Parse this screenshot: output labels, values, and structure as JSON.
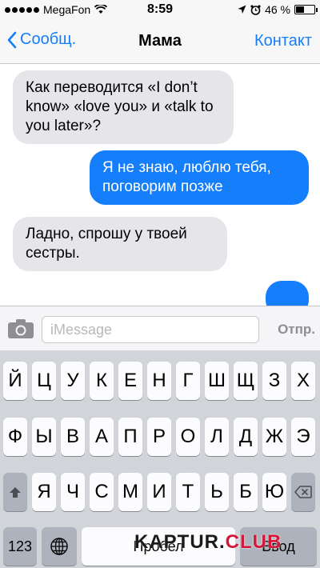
{
  "status_bar": {
    "carrier": "MegaFon",
    "time": "8:59",
    "battery_percent": "46 %",
    "battery_level": 0.46,
    "icons": [
      "signal-dots",
      "wifi-icon",
      "location-arrow-icon",
      "alarm-icon",
      "battery-icon"
    ]
  },
  "nav": {
    "back_label": "Сообщ.",
    "title": "Мама",
    "contact_label": "Контакт"
  },
  "messages": [
    {
      "direction": "in",
      "text": "Как переводится «I don’t know» «love you» и «talk to you later»?"
    },
    {
      "direction": "out",
      "text": "Я не знаю, люблю тебя, поговорим позже"
    },
    {
      "direction": "in",
      "text": "Ладно, спрошу у твоей сестры."
    },
    {
      "direction": "out",
      "text": ""
    }
  ],
  "input": {
    "placeholder": "iMessage",
    "value": "",
    "send_label": "Отпр."
  },
  "keyboard": {
    "row1": [
      "Й",
      "Ц",
      "У",
      "К",
      "Е",
      "Н",
      "Г",
      "Ш",
      "Щ",
      "З",
      "Х"
    ],
    "row2": [
      "Ф",
      "Ы",
      "В",
      "А",
      "П",
      "Р",
      "О",
      "Л",
      "Д",
      "Ж",
      "Э"
    ],
    "row3": [
      "Я",
      "Ч",
      "С",
      "М",
      "И",
      "Т",
      "Ь",
      "Б",
      "Ю"
    ],
    "numbers_label": "123",
    "space_label": "Пробел",
    "return_label": "Ввод"
  },
  "watermark": {
    "prefix": "KAPTUR.",
    "suffix": "CLUB"
  },
  "colors": {
    "accent": "#157efb",
    "incoming_bubble": "#e5e5ea",
    "outgoing_bubble": "#157efb",
    "keyboard_bg": "#d1d4d9"
  }
}
